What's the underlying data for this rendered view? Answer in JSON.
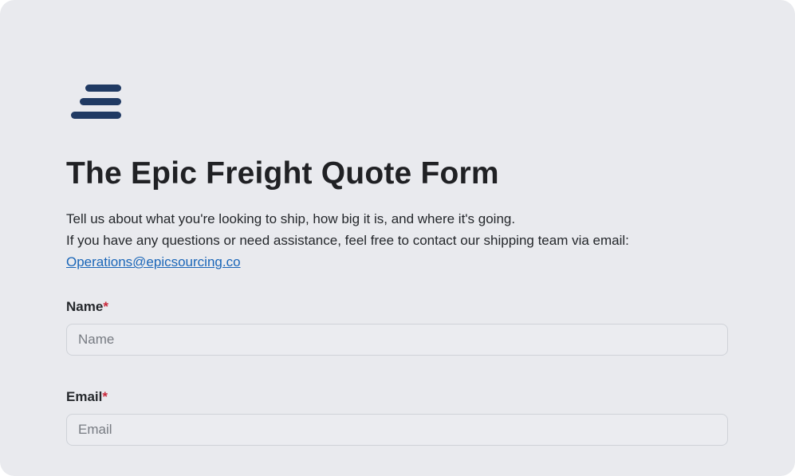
{
  "form": {
    "title": "The Epic Freight Quote Form",
    "description_line1": "Tell us about what you're looking to ship, how big it is, and where it's going.",
    "description_line2": "If you have any questions or need assistance, feel free to contact our shipping team via email:",
    "contact_email": "Operations@epicsourcing.co",
    "fields": [
      {
        "label": "Name",
        "required_mark": "*",
        "placeholder": "Name",
        "value": ""
      },
      {
        "label": "Email",
        "required_mark": "*",
        "placeholder": "Email",
        "value": ""
      }
    ]
  },
  "logo": {
    "icon": "stacked-bars-logo",
    "color": "#203a63"
  },
  "colors": {
    "background": "#e9eaee",
    "link": "#1a66b8",
    "required": "#c8283a"
  }
}
